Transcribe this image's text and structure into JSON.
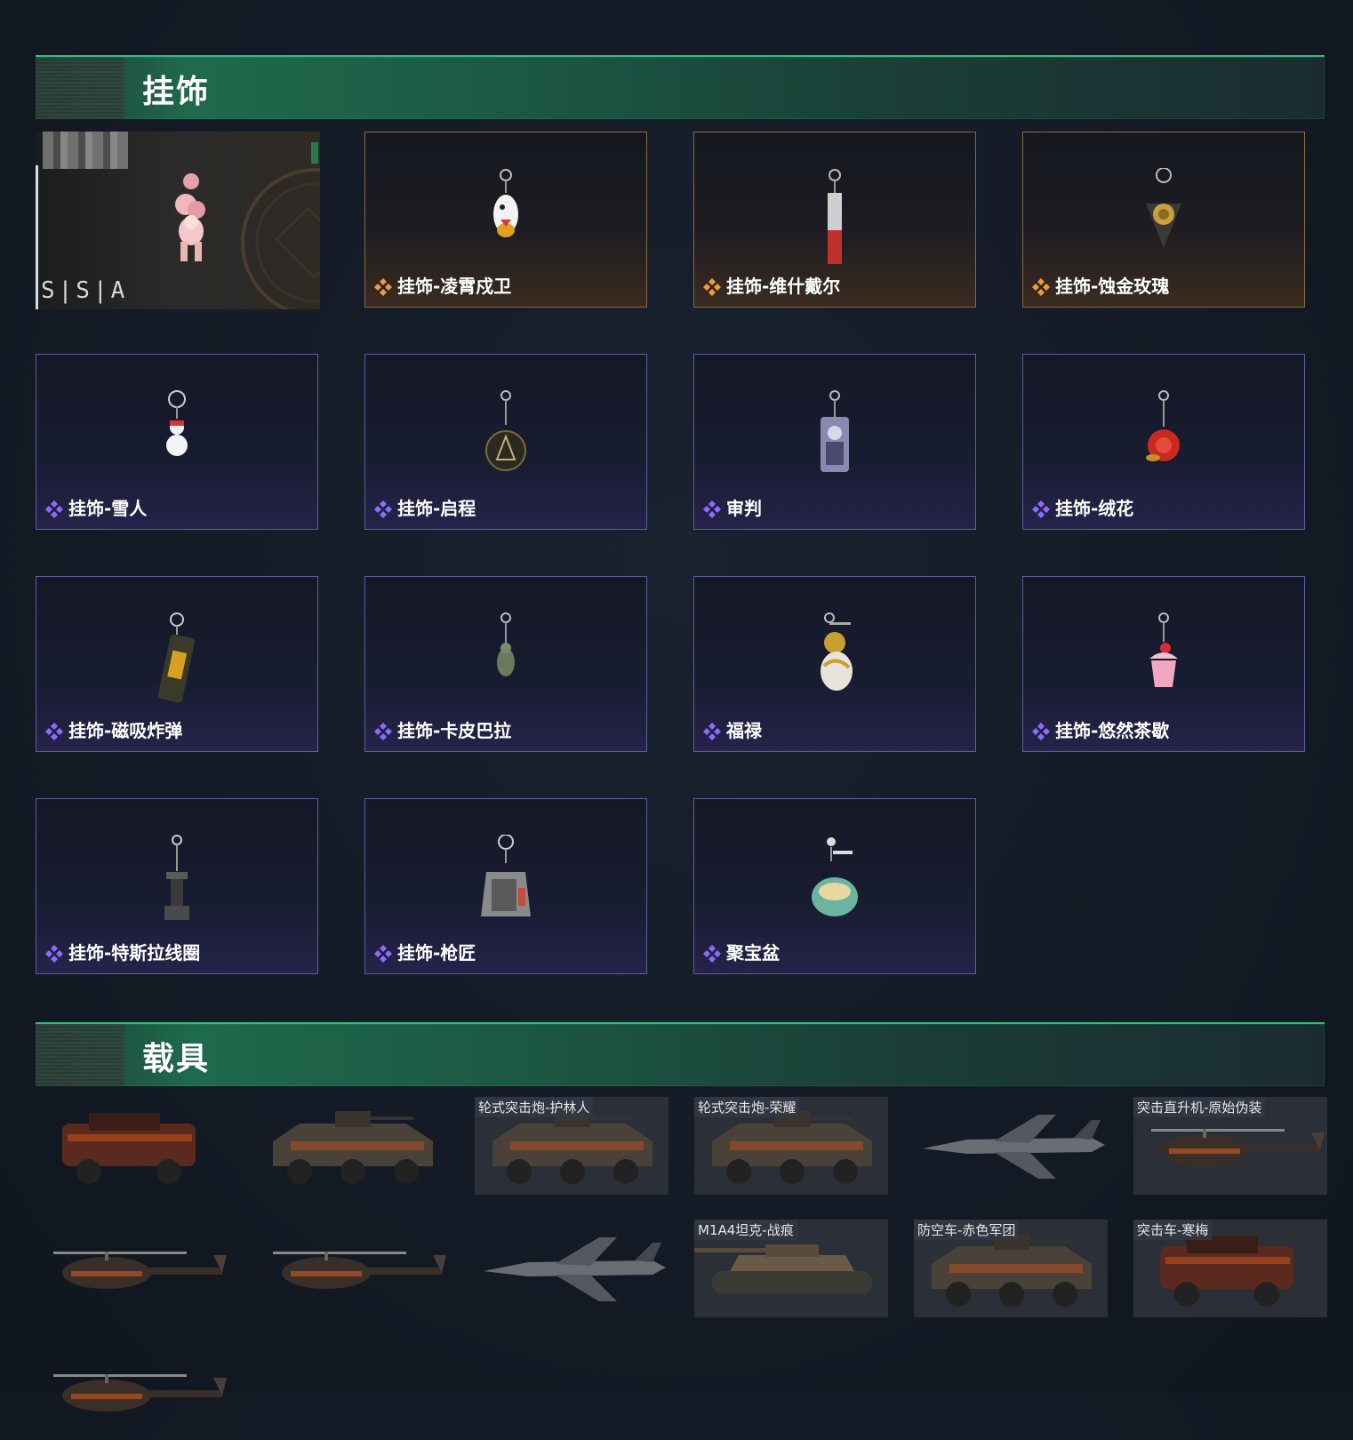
{
  "sections": {
    "charms_title": "挂饰",
    "vehicles_title": "载具"
  },
  "featured": {
    "watermark": "S|S|A"
  },
  "charms": [
    {
      "label": "挂饰-凌霄戍卫",
      "rarity": "gold"
    },
    {
      "label": "挂饰-维什戴尔",
      "rarity": "gold"
    },
    {
      "label": "挂饰-蚀金玫瑰",
      "rarity": "gold"
    },
    {
      "label": "挂饰-雪人",
      "rarity": "purple"
    },
    {
      "label": "挂饰-启程",
      "rarity": "purple"
    },
    {
      "label": "审判",
      "rarity": "purple"
    },
    {
      "label": "挂饰-绒花",
      "rarity": "purple"
    },
    {
      "label": "挂饰-磁吸炸弹",
      "rarity": "purple"
    },
    {
      "label": "挂饰-卡皮巴拉",
      "rarity": "purple"
    },
    {
      "label": "福禄",
      "rarity": "purple"
    },
    {
      "label": "挂饰-悠然茶歇",
      "rarity": "purple"
    },
    {
      "label": "挂饰-特斯拉线圈",
      "rarity": "purple"
    },
    {
      "label": "挂饰-枪匠",
      "rarity": "purple"
    },
    {
      "label": "聚宝盆",
      "rarity": "purple"
    }
  ],
  "vehicles": [
    {
      "label": "",
      "kind": "suv"
    },
    {
      "label": "",
      "kind": "apc"
    },
    {
      "label": "轮式突击炮-护林人",
      "kind": "apc"
    },
    {
      "label": "轮式突击炮-荣耀",
      "kind": "apc"
    },
    {
      "label": "",
      "kind": "jet"
    },
    {
      "label": "突击直升机-原始伪装",
      "kind": "heli"
    },
    {
      "label": "",
      "kind": "heli"
    },
    {
      "label": "",
      "kind": "heli"
    },
    {
      "label": "",
      "kind": "jet"
    },
    {
      "label": "M1A4坦克-战痕",
      "kind": "tank"
    },
    {
      "label": "防空车-赤色军团",
      "kind": "apc"
    },
    {
      "label": "突击车-寒梅",
      "kind": "suv"
    },
    {
      "label": "",
      "kind": "heli"
    }
  ],
  "colors": {
    "accent_green": "#2fbf80",
    "purple_border": "#5b5fa0",
    "gold_border": "#8a6a3a",
    "diamond_purple": "#8d6bff",
    "diamond_gold": "#f29a3a"
  }
}
